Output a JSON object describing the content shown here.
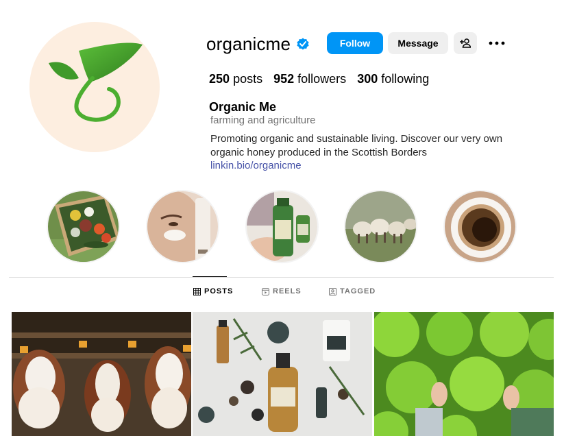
{
  "profile": {
    "username": "organicme",
    "verified_icon": "verified-badge-icon",
    "follow_label": "Follow",
    "message_label": "Message",
    "add_user_icon": "add-user-icon",
    "more_icon": "more-options-icon",
    "avatar_icon": "sprout-logo-icon"
  },
  "stats": [
    {
      "count": "250",
      "label": "posts"
    },
    {
      "count": "952",
      "label": "followers"
    },
    {
      "count": "300",
      "label": "following"
    }
  ],
  "bio": {
    "name": "Organic Me",
    "category": "farming and agriculture",
    "text": "Promoting organic and sustainable living. Discover our very own organic honey produced in the Scottish Borders",
    "link": "linkin.bio/organicme"
  },
  "highlights": [
    {
      "name": "vegetables-basket"
    },
    {
      "name": "face-cream"
    },
    {
      "name": "organic-shampoo"
    },
    {
      "name": "sheep-field"
    },
    {
      "name": "coffee-cup"
    }
  ],
  "tabs": [
    {
      "label": "POSTS",
      "icon": "grid-icon",
      "active": true
    },
    {
      "label": "REELS",
      "icon": "reels-icon",
      "active": false
    },
    {
      "label": "TAGGED",
      "icon": "tagged-icon",
      "active": false
    }
  ],
  "posts": [
    {
      "name": "calves-in-barn"
    },
    {
      "name": "organic-skincare-flatlay"
    },
    {
      "name": "lettuce-harvest"
    }
  ],
  "colors": {
    "accent": "#0095f6",
    "link": "#4753a8",
    "avatar_bg": "#fdeee0",
    "leaf_green": "#3f9a2a"
  }
}
